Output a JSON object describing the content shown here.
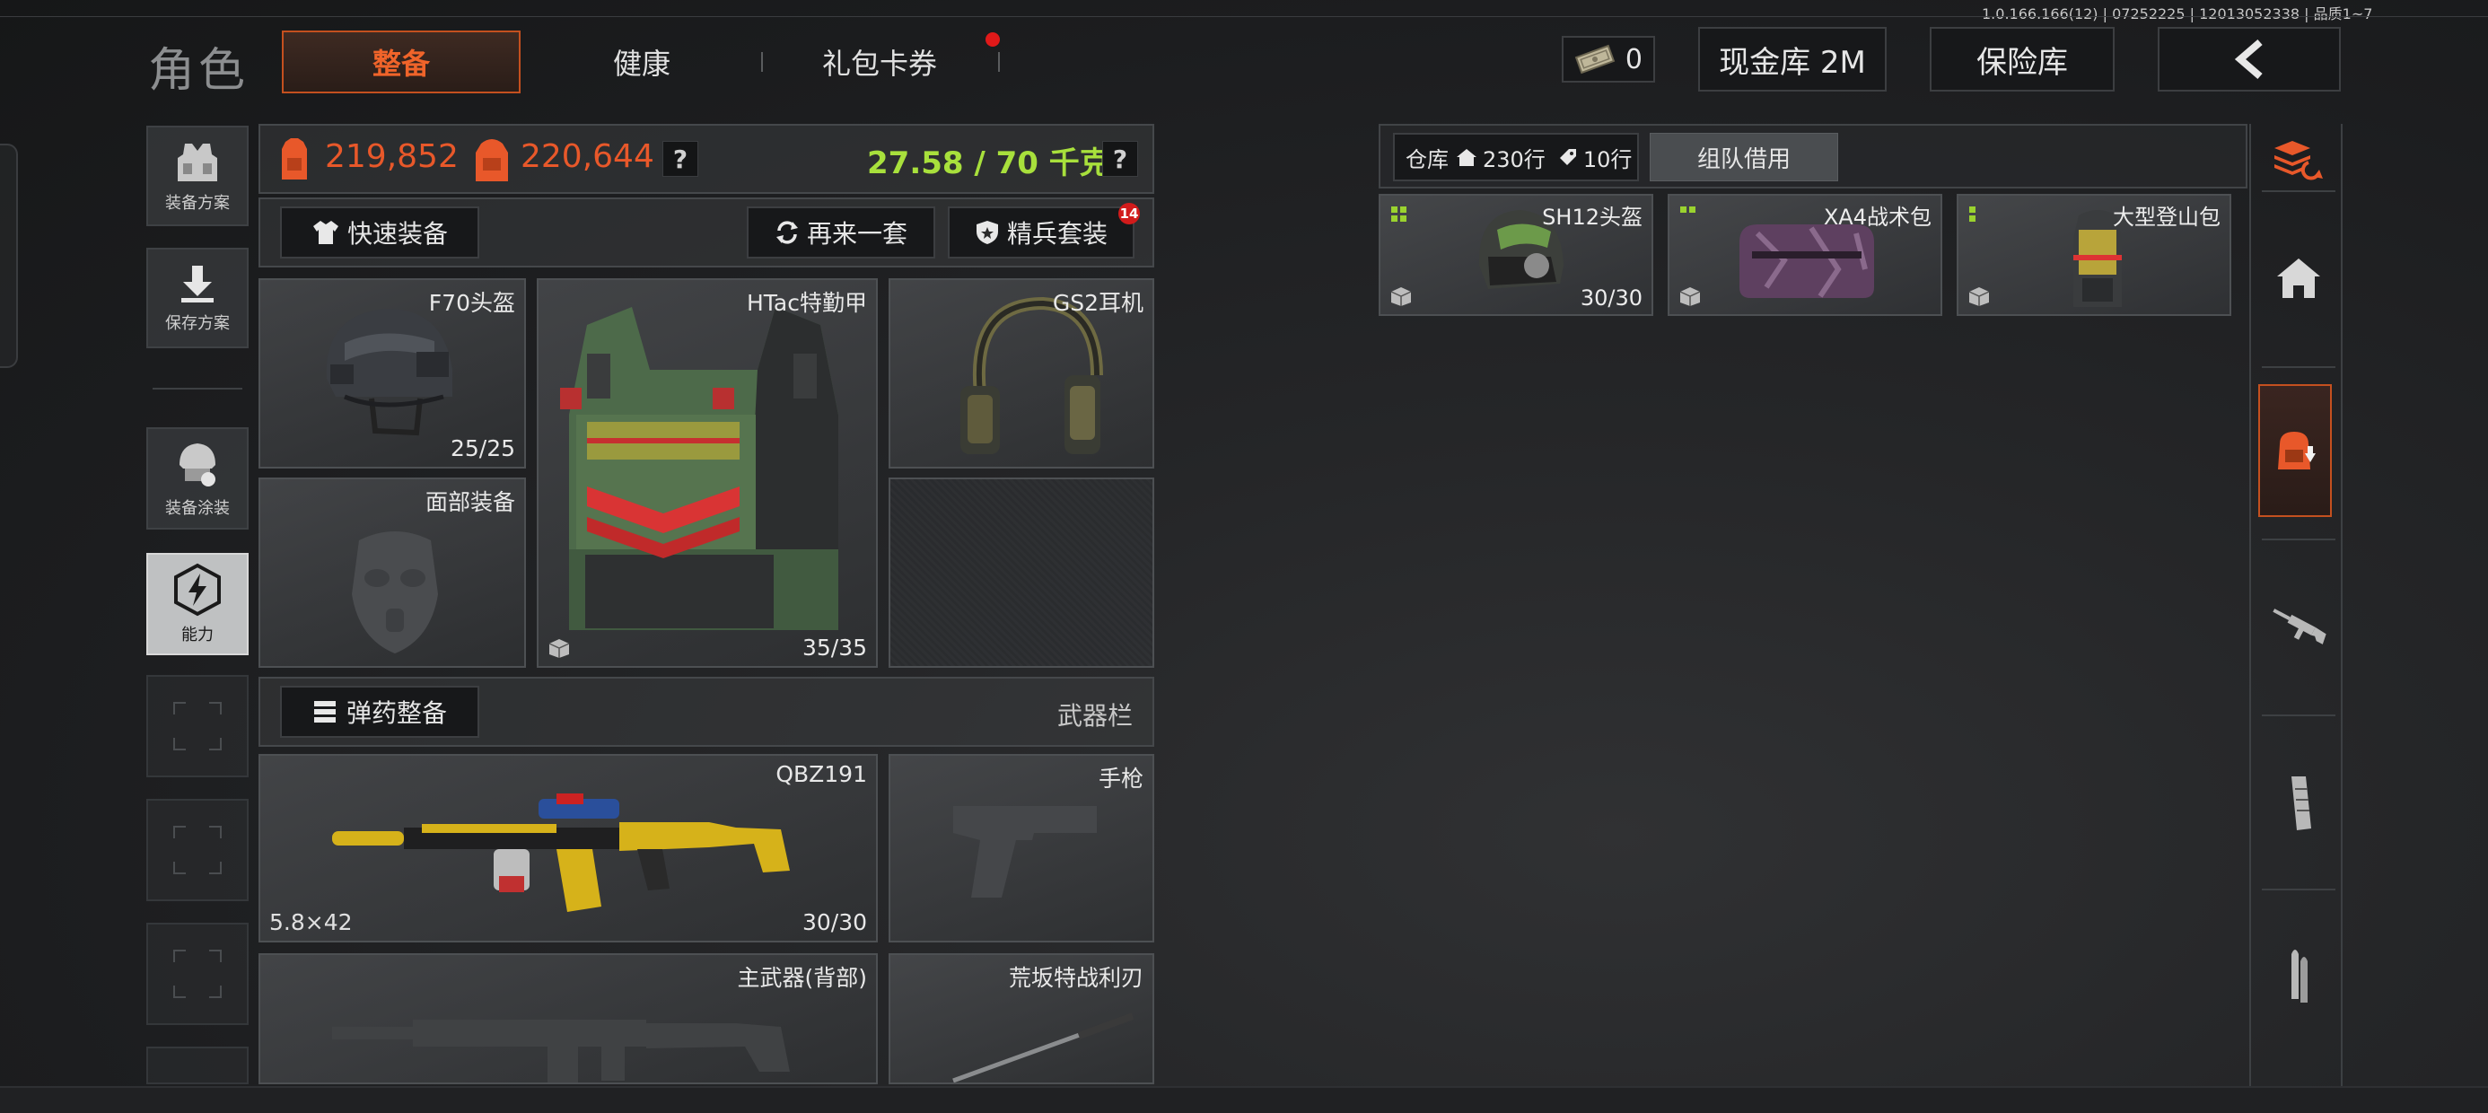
{
  "version_info": "1.0.166.166(12) | 07252225 | 12013052338 | 品质1~7",
  "top_nav": {
    "section_title": "角色",
    "tabs": [
      {
        "label": "整备",
        "active": true
      },
      {
        "label": "健康",
        "active": false
      },
      {
        "label": "礼包卡券",
        "active": false,
        "has_notification": true
      }
    ],
    "currency_value": "0",
    "cash_vault_label": "现金库 2M",
    "safe_label": "保险库",
    "back_icon": "chevron-left-icon"
  },
  "left_sidebar": {
    "items": [
      {
        "label": "装备方案",
        "icon": "vest-icon"
      },
      {
        "label": "保存方案",
        "icon": "download-icon"
      },
      {
        "label": "装备涂装",
        "icon": "helmet-paint-icon"
      },
      {
        "label": "能力",
        "icon": "ability-bolt-icon",
        "selected": true
      }
    ]
  },
  "stats": {
    "value_1": "219,852",
    "value_2": "220,644",
    "help_1": "?",
    "weight": "27.58 / 70 千克",
    "help_2": "?",
    "accent_color": "#e8582a",
    "weight_color": "#a8e03c"
  },
  "actions": {
    "quick_equip": "快速装备",
    "again": "再来一套",
    "elite_set": "精兵套装",
    "elite_badge": "14"
  },
  "gear_slots": {
    "helmet": {
      "label": "F70头盔",
      "count": "25/25"
    },
    "armor": {
      "label": "HTac特勤甲",
      "count": "35/35"
    },
    "headset": {
      "label": "GS2耳机"
    },
    "face": {
      "label": "面部装备"
    }
  },
  "ammo_bar": {
    "ammo_button": "弹药整备",
    "weapon_bar_label": "武器栏"
  },
  "weapon_slots": {
    "primary": {
      "label": "QBZ191",
      "caliber": "5.8×42",
      "count": "30/30"
    },
    "pistol": {
      "label": "手枪"
    },
    "back_weapon": {
      "label": "主武器(背部)"
    },
    "melee": {
      "label": "荒坂特战利刃"
    }
  },
  "warehouse": {
    "tab_label": "仓库",
    "rows_a": "230行",
    "rows_b": "10行",
    "team_borrow": "组队借用",
    "items": [
      {
        "label": "SH12头盔",
        "count": "30/30"
      },
      {
        "label": "XA4战术包",
        "count": ""
      },
      {
        "label": "大型登山包",
        "count": ""
      }
    ]
  },
  "right_sidebar": {
    "icons": [
      "layers-refresh-icon",
      "home-icon",
      "bag-download-icon",
      "rifle-icon",
      "magazine-icon",
      "bullet-icon"
    ]
  }
}
